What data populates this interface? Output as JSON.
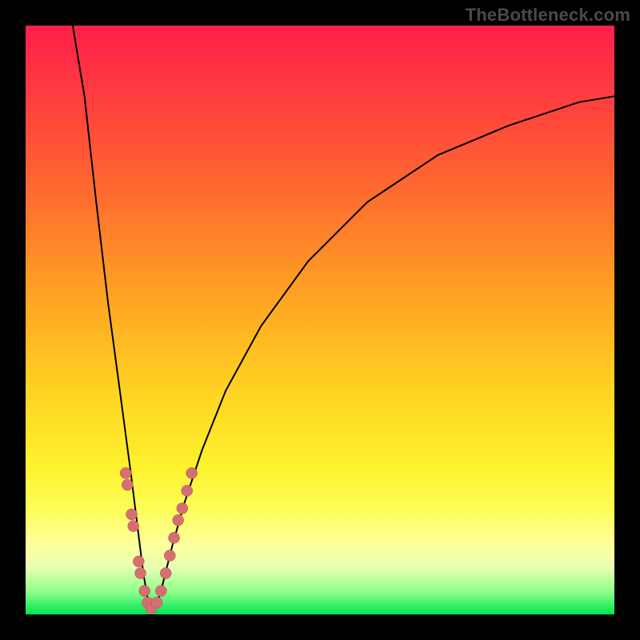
{
  "watermark": "TheBottleneck.com",
  "chart_data": {
    "type": "line",
    "title": "",
    "xlabel": "",
    "ylabel": "",
    "xlim": [
      0,
      100
    ],
    "ylim": [
      0,
      100
    ],
    "curve": {
      "name": "bottleneck-curve",
      "minimum_x": 21,
      "points": [
        {
          "x": 8,
          "y": 100
        },
        {
          "x": 10,
          "y": 88
        },
        {
          "x": 12,
          "y": 70
        },
        {
          "x": 14,
          "y": 53
        },
        {
          "x": 16,
          "y": 38
        },
        {
          "x": 18,
          "y": 23
        },
        {
          "x": 19,
          "y": 15
        },
        {
          "x": 20,
          "y": 7
        },
        {
          "x": 21,
          "y": 1
        },
        {
          "x": 22,
          "y": 1
        },
        {
          "x": 23,
          "y": 4
        },
        {
          "x": 24,
          "y": 8
        },
        {
          "x": 25,
          "y": 12
        },
        {
          "x": 27,
          "y": 19
        },
        {
          "x": 30,
          "y": 28
        },
        {
          "x": 34,
          "y": 38
        },
        {
          "x": 40,
          "y": 49
        },
        {
          "x": 48,
          "y": 60
        },
        {
          "x": 58,
          "y": 70
        },
        {
          "x": 70,
          "y": 78
        },
        {
          "x": 82,
          "y": 83
        },
        {
          "x": 94,
          "y": 87
        },
        {
          "x": 100,
          "y": 88
        }
      ]
    },
    "series": [
      {
        "name": "left-cluster",
        "color": "#d66f71",
        "values": [
          {
            "x": 17.0,
            "y": 24
          },
          {
            "x": 17.3,
            "y": 22
          },
          {
            "x": 18.0,
            "y": 17
          },
          {
            "x": 18.3,
            "y": 15
          },
          {
            "x": 19.2,
            "y": 9
          },
          {
            "x": 19.5,
            "y": 7
          },
          {
            "x": 20.2,
            "y": 4
          },
          {
            "x": 20.7,
            "y": 2
          },
          {
            "x": 21.3,
            "y": 1
          }
        ]
      },
      {
        "name": "right-cluster",
        "color": "#d66f71",
        "values": [
          {
            "x": 22.3,
            "y": 2
          },
          {
            "x": 23.0,
            "y": 4
          },
          {
            "x": 23.8,
            "y": 7
          },
          {
            "x": 24.5,
            "y": 10
          },
          {
            "x": 25.2,
            "y": 13
          },
          {
            "x": 25.9,
            "y": 16
          },
          {
            "x": 26.6,
            "y": 18
          },
          {
            "x": 27.4,
            "y": 21
          },
          {
            "x": 28.2,
            "y": 24
          }
        ]
      }
    ],
    "gradient_stops": [
      {
        "pos": 0,
        "color": "#ff1f4b"
      },
      {
        "pos": 12,
        "color": "#ff3d3f"
      },
      {
        "pos": 28,
        "color": "#ff6a2f"
      },
      {
        "pos": 45,
        "color": "#ffa023"
      },
      {
        "pos": 62,
        "color": "#ffd322"
      },
      {
        "pos": 75,
        "color": "#fef22e"
      },
      {
        "pos": 82,
        "color": "#fdfd58"
      },
      {
        "pos": 88,
        "color": "#feff9a"
      },
      {
        "pos": 92,
        "color": "#e7ffb2"
      },
      {
        "pos": 96,
        "color": "#94ff8e"
      },
      {
        "pos": 100,
        "color": "#00e551"
      }
    ]
  }
}
